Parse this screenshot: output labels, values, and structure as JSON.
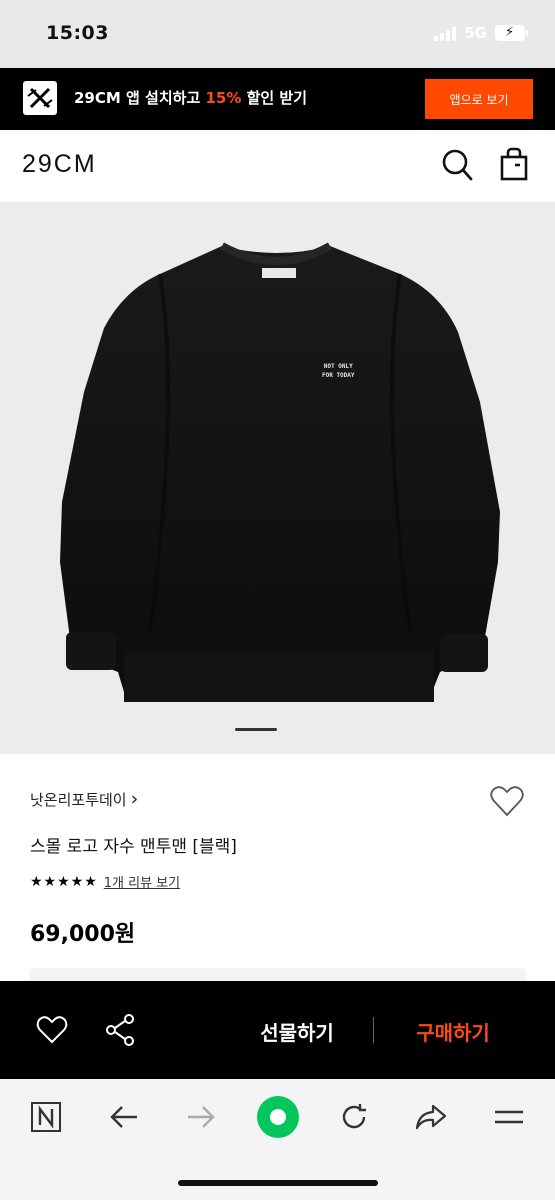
{
  "status_bar": {
    "time": "15:03",
    "network": "5G"
  },
  "promo": {
    "text_before": "29CM 앱 설치하고 ",
    "highlight": "15%",
    "text_after": " 할인 받기",
    "button": "앱으로 보기",
    "highlight_color": "#ff4b14"
  },
  "header": {
    "logo": "29CM",
    "icons": [
      "search-icon",
      "shopping-bag-icon"
    ]
  },
  "product": {
    "image_alt": "black crewneck sweatshirt",
    "embroidery_line1": "NOT ONLY",
    "embroidery_line2": "FOR TODAY",
    "brand": "낫온리포투데이",
    "brand_chevron": "›",
    "name": "스몰 로고 자수 맨투맨 [블랙]",
    "stars": "★★★★★",
    "review_link": "1개 리뷰 보기",
    "price": "69,000원"
  },
  "action_bar": {
    "gift_button": "선물하기",
    "buy_button": "구매하기",
    "buy_color": "#ff4a10",
    "icons": [
      "heart-icon",
      "share-icon"
    ]
  },
  "browser_bar": {
    "icons": [
      "naver-n-icon",
      "back-arrow-icon",
      "forward-arrow-icon",
      "home-green-circle-icon",
      "reload-icon",
      "share-arrow-icon",
      "menu-icon"
    ]
  }
}
